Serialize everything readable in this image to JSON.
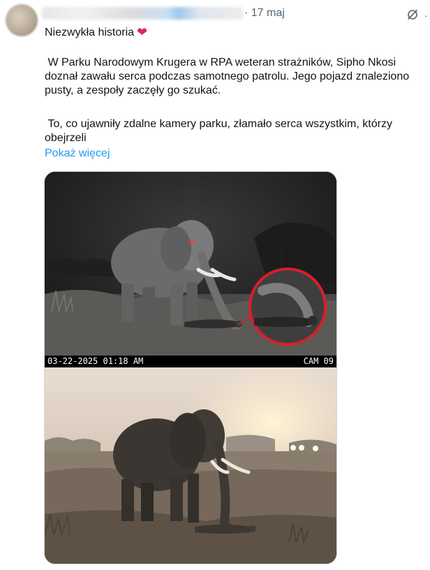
{
  "tweet": {
    "date": "· 17 maj",
    "headline": "Niezwykła historia",
    "headline_emoji": "❤",
    "paragraph1": " W Parku Narodowym Krugera w RPA weteran strażników, Sipho Nkosi doznał zawału serca podczas samotnego patrolu. Jego pojazd znaleziono pusty, a zespoły zaczęły go szukać.",
    "paragraph2": " To, co ujawniły zdalne kamery parku, złamało serca wszystkim, którzy obejrzeli",
    "show_more": "Pokaż więcej",
    "more_glyph": "·"
  },
  "media": {
    "camera_timestamp": "03-22-2025 01:18 AM",
    "camera_id": "CAM 09"
  },
  "icons": {
    "edit": "edit-history-icon",
    "heart": "red-heart-emoji"
  },
  "colors": {
    "link": "#1d9bf0",
    "secondary_text": "#536471",
    "text": "#0f1419",
    "heart": "#e0245e",
    "highlight_circle": "#d6202b"
  }
}
